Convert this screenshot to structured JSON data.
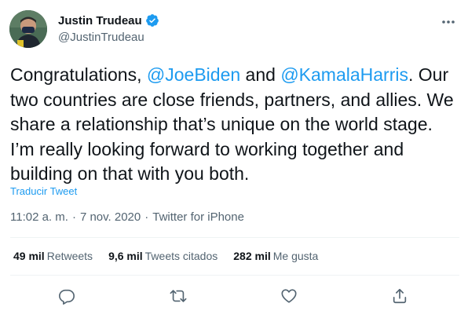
{
  "author": {
    "display_name": "Justin Trudeau",
    "handle": "@JustinTrudeau",
    "verified": true,
    "avatar_icon": "profile-photo-masked-man"
  },
  "tweet": {
    "text_before": "Congratulations, ",
    "mention_1": "@JoeBiden",
    "text_mid": " and ",
    "mention_2": "@KamalaHarris",
    "text_after": ". Our two countries are close friends, partners, and allies. We share a relationship that’s unique on the world stage. I’m really looking forward to working together and building on that with you both.",
    "translate_label": "Traducir Tweet"
  },
  "meta": {
    "time": "11:02 a. m.",
    "date": "7 nov. 2020",
    "source": "Twitter for iPhone",
    "separator": "·"
  },
  "stats": {
    "retweets_count": "49 mil",
    "retweets_label": "Retweets",
    "quotes_count": "9,6 mil",
    "quotes_label": "Tweets citados",
    "likes_count": "282 mil",
    "likes_label": "Me gusta"
  },
  "icons": {
    "more": "more-horizontal-icon",
    "reply": "reply-icon",
    "retweet": "retweet-icon",
    "like": "heart-icon",
    "share": "share-icon"
  },
  "colors": {
    "accent": "#1d9bf0",
    "text": "#0f1419",
    "secondary": "#536471",
    "divider": "#eff3f4"
  }
}
